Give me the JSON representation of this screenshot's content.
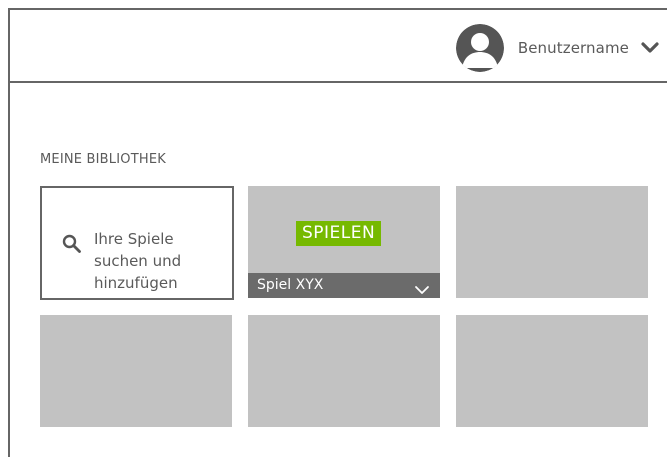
{
  "header": {
    "username": "Benutzername",
    "avatar_icon": "user-avatar-icon",
    "dropdown_icon": "chevron-down-icon"
  },
  "library": {
    "title": "MEINE BIBLIOTHEK",
    "search_tile": {
      "icon": "search-icon",
      "line1": "Ihre Spiele",
      "line2": "suchen und",
      "line3": "hinzufügen"
    },
    "featured_game": {
      "play_label": "SPIELEN",
      "name": "Spiel XYX",
      "dropdown_icon": "chevron-down-icon"
    }
  },
  "colors": {
    "accent": "#76b900",
    "tile": "#c2c2c2",
    "bar": "#6b6b6b",
    "border": "#666666"
  }
}
